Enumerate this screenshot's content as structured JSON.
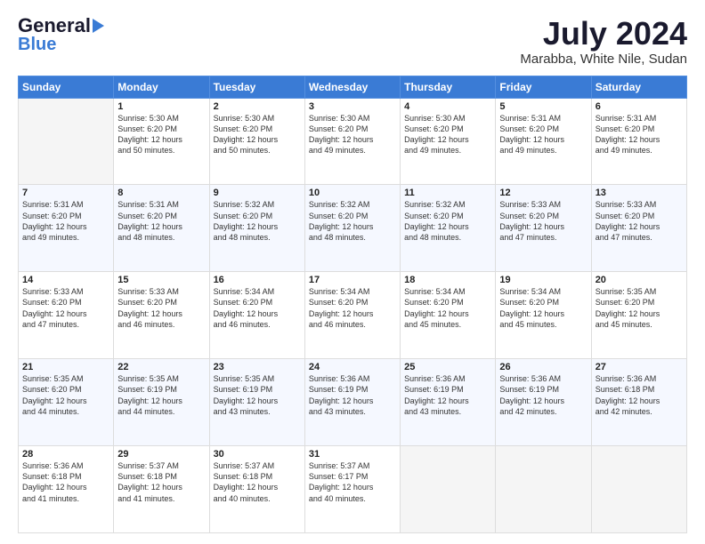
{
  "header": {
    "logo_general": "General",
    "logo_blue": "Blue",
    "main_title": "July 2024",
    "subtitle": "Marabba, White Nile, Sudan"
  },
  "calendar": {
    "days_of_week": [
      "Sunday",
      "Monday",
      "Tuesday",
      "Wednesday",
      "Thursday",
      "Friday",
      "Saturday"
    ],
    "weeks": [
      [
        {
          "day": "",
          "info": ""
        },
        {
          "day": "1",
          "info": "Sunrise: 5:30 AM\nSunset: 6:20 PM\nDaylight: 12 hours\nand 50 minutes."
        },
        {
          "day": "2",
          "info": "Sunrise: 5:30 AM\nSunset: 6:20 PM\nDaylight: 12 hours\nand 50 minutes."
        },
        {
          "day": "3",
          "info": "Sunrise: 5:30 AM\nSunset: 6:20 PM\nDaylight: 12 hours\nand 49 minutes."
        },
        {
          "day": "4",
          "info": "Sunrise: 5:30 AM\nSunset: 6:20 PM\nDaylight: 12 hours\nand 49 minutes."
        },
        {
          "day": "5",
          "info": "Sunrise: 5:31 AM\nSunset: 6:20 PM\nDaylight: 12 hours\nand 49 minutes."
        },
        {
          "day": "6",
          "info": "Sunrise: 5:31 AM\nSunset: 6:20 PM\nDaylight: 12 hours\nand 49 minutes."
        }
      ],
      [
        {
          "day": "7",
          "info": "Sunrise: 5:31 AM\nSunset: 6:20 PM\nDaylight: 12 hours\nand 49 minutes."
        },
        {
          "day": "8",
          "info": "Sunrise: 5:31 AM\nSunset: 6:20 PM\nDaylight: 12 hours\nand 48 minutes."
        },
        {
          "day": "9",
          "info": "Sunrise: 5:32 AM\nSunset: 6:20 PM\nDaylight: 12 hours\nand 48 minutes."
        },
        {
          "day": "10",
          "info": "Sunrise: 5:32 AM\nSunset: 6:20 PM\nDaylight: 12 hours\nand 48 minutes."
        },
        {
          "day": "11",
          "info": "Sunrise: 5:32 AM\nSunset: 6:20 PM\nDaylight: 12 hours\nand 48 minutes."
        },
        {
          "day": "12",
          "info": "Sunrise: 5:33 AM\nSunset: 6:20 PM\nDaylight: 12 hours\nand 47 minutes."
        },
        {
          "day": "13",
          "info": "Sunrise: 5:33 AM\nSunset: 6:20 PM\nDaylight: 12 hours\nand 47 minutes."
        }
      ],
      [
        {
          "day": "14",
          "info": "Sunrise: 5:33 AM\nSunset: 6:20 PM\nDaylight: 12 hours\nand 47 minutes."
        },
        {
          "day": "15",
          "info": "Sunrise: 5:33 AM\nSunset: 6:20 PM\nDaylight: 12 hours\nand 46 minutes."
        },
        {
          "day": "16",
          "info": "Sunrise: 5:34 AM\nSunset: 6:20 PM\nDaylight: 12 hours\nand 46 minutes."
        },
        {
          "day": "17",
          "info": "Sunrise: 5:34 AM\nSunset: 6:20 PM\nDaylight: 12 hours\nand 46 minutes."
        },
        {
          "day": "18",
          "info": "Sunrise: 5:34 AM\nSunset: 6:20 PM\nDaylight: 12 hours\nand 45 minutes."
        },
        {
          "day": "19",
          "info": "Sunrise: 5:34 AM\nSunset: 6:20 PM\nDaylight: 12 hours\nand 45 minutes."
        },
        {
          "day": "20",
          "info": "Sunrise: 5:35 AM\nSunset: 6:20 PM\nDaylight: 12 hours\nand 45 minutes."
        }
      ],
      [
        {
          "day": "21",
          "info": "Sunrise: 5:35 AM\nSunset: 6:20 PM\nDaylight: 12 hours\nand 44 minutes."
        },
        {
          "day": "22",
          "info": "Sunrise: 5:35 AM\nSunset: 6:19 PM\nDaylight: 12 hours\nand 44 minutes."
        },
        {
          "day": "23",
          "info": "Sunrise: 5:35 AM\nSunset: 6:19 PM\nDaylight: 12 hours\nand 43 minutes."
        },
        {
          "day": "24",
          "info": "Sunrise: 5:36 AM\nSunset: 6:19 PM\nDaylight: 12 hours\nand 43 minutes."
        },
        {
          "day": "25",
          "info": "Sunrise: 5:36 AM\nSunset: 6:19 PM\nDaylight: 12 hours\nand 43 minutes."
        },
        {
          "day": "26",
          "info": "Sunrise: 5:36 AM\nSunset: 6:19 PM\nDaylight: 12 hours\nand 42 minutes."
        },
        {
          "day": "27",
          "info": "Sunrise: 5:36 AM\nSunset: 6:18 PM\nDaylight: 12 hours\nand 42 minutes."
        }
      ],
      [
        {
          "day": "28",
          "info": "Sunrise: 5:36 AM\nSunset: 6:18 PM\nDaylight: 12 hours\nand 41 minutes."
        },
        {
          "day": "29",
          "info": "Sunrise: 5:37 AM\nSunset: 6:18 PM\nDaylight: 12 hours\nand 41 minutes."
        },
        {
          "day": "30",
          "info": "Sunrise: 5:37 AM\nSunset: 6:18 PM\nDaylight: 12 hours\nand 40 minutes."
        },
        {
          "day": "31",
          "info": "Sunrise: 5:37 AM\nSunset: 6:17 PM\nDaylight: 12 hours\nand 40 minutes."
        },
        {
          "day": "",
          "info": ""
        },
        {
          "day": "",
          "info": ""
        },
        {
          "day": "",
          "info": ""
        }
      ]
    ]
  }
}
